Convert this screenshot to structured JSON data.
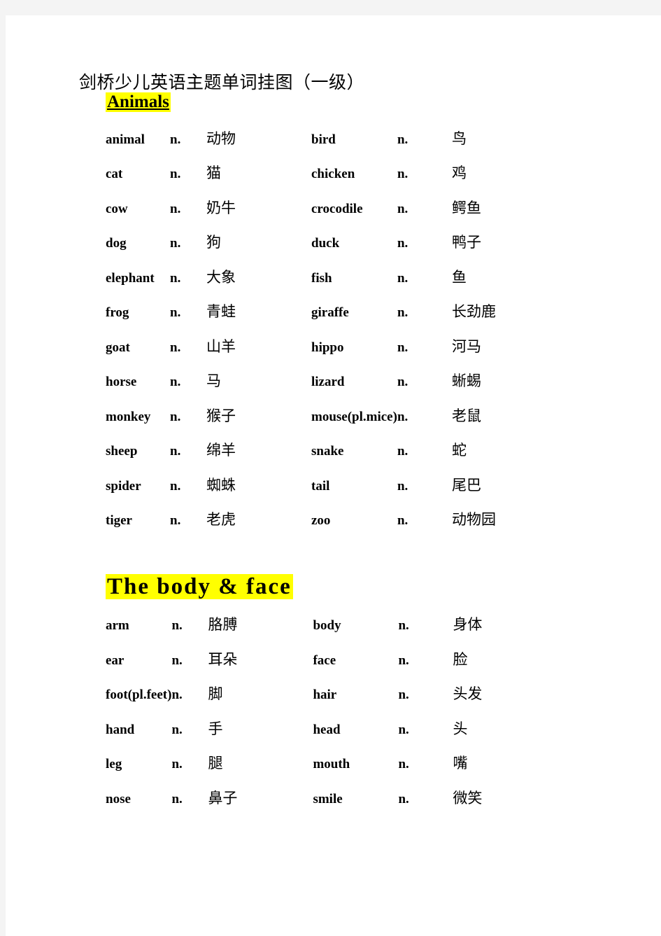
{
  "document": {
    "title": "剑桥少儿英语主题单词挂图（一级）",
    "page_background": "#ffffff",
    "margin_background": "#f4f4f4",
    "highlight_color": "#ffff00",
    "text_color": "#000000"
  },
  "sections": [
    {
      "id": "animals",
      "heading": "Animals",
      "heading_style": "small-underline-highlight",
      "rows": [
        {
          "left": {
            "word": "animal",
            "pos": "n.",
            "zh": "动物"
          },
          "right": {
            "word": "bird",
            "pos": "n.",
            "zh": "鸟"
          }
        },
        {
          "left": {
            "word": "cat",
            "pos": "n.",
            "zh": "猫"
          },
          "right": {
            "word": "chicken",
            "pos": "n.",
            "zh": "鸡"
          }
        },
        {
          "left": {
            "word": "cow",
            "pos": "n.",
            "zh": "奶牛"
          },
          "right": {
            "word": "crocodile",
            "pos": "n.",
            "zh": "鳄鱼"
          }
        },
        {
          "left": {
            "word": "dog",
            "pos": "n.",
            "zh": "狗"
          },
          "right": {
            "word": "duck",
            "pos": "n.",
            "zh": "鸭子"
          }
        },
        {
          "left": {
            "word": "elephant",
            "pos": "n.",
            "zh": "大象"
          },
          "right": {
            "word": "fish",
            "pos": "n.",
            "zh": "鱼"
          }
        },
        {
          "left": {
            "word": "frog",
            "pos": "n.",
            "zh": "青蛙"
          },
          "right": {
            "word": "giraffe",
            "pos": "n.",
            "zh": "长劲鹿"
          }
        },
        {
          "left": {
            "word": "goat",
            "pos": "n.",
            "zh": "山羊"
          },
          "right": {
            "word": "hippo",
            "pos": "n.",
            "zh": "河马"
          }
        },
        {
          "left": {
            "word": "horse",
            "pos": "n.",
            "zh": "马"
          },
          "right": {
            "word": "lizard",
            "pos": "n.",
            "zh": "蜥蜴"
          }
        },
        {
          "left": {
            "word": "monkey",
            "pos": "n.",
            "zh": "猴子"
          },
          "right": {
            "word": "mouse(pl.mice)",
            "pos": "n.",
            "zh": "老鼠"
          }
        },
        {
          "left": {
            "word": "sheep",
            "pos": "n.",
            "zh": "绵羊"
          },
          "right": {
            "word": "snake",
            "pos": "n.",
            "zh": "蛇"
          }
        },
        {
          "left": {
            "word": "spider",
            "pos": "n.",
            "zh": "蜘蛛"
          },
          "right": {
            "word": "tail",
            "pos": "n.",
            "zh": "尾巴"
          }
        },
        {
          "left": {
            "word": "tiger",
            "pos": "n.",
            "zh": "老虎"
          },
          "right": {
            "word": "zoo",
            "pos": "n.",
            "zh": "动物园"
          }
        }
      ]
    },
    {
      "id": "body-face",
      "heading": "The  body  &  face",
      "heading_style": "large-highlight",
      "rows": [
        {
          "left": {
            "word": "arm",
            "pos": "n.",
            "zh": "胳膊"
          },
          "right": {
            "word": "body",
            "pos": "n.",
            "zh": "身体"
          }
        },
        {
          "left": {
            "word": "ear",
            "pos": "n.",
            "zh": "耳朵"
          },
          "right": {
            "word": "face",
            "pos": "n.",
            "zh": "脸"
          }
        },
        {
          "left": {
            "word": "foot(pl.feet)",
            "pos": "n.",
            "zh": "脚"
          },
          "right": {
            "word": "hair",
            "pos": "n.",
            "zh": "头发"
          }
        },
        {
          "left": {
            "word": "hand",
            "pos": "n.",
            "zh": "手"
          },
          "right": {
            "word": "head",
            "pos": "n.",
            "zh": "头"
          }
        },
        {
          "left": {
            "word": "leg",
            "pos": "n.",
            "zh": "腿"
          },
          "right": {
            "word": "mouth",
            "pos": "n.",
            "zh": "嘴"
          }
        },
        {
          "left": {
            "word": "nose",
            "pos": "n.",
            "zh": "鼻子"
          },
          "right": {
            "word": "smile",
            "pos": "n.",
            "zh": "微笑"
          }
        }
      ]
    }
  ]
}
